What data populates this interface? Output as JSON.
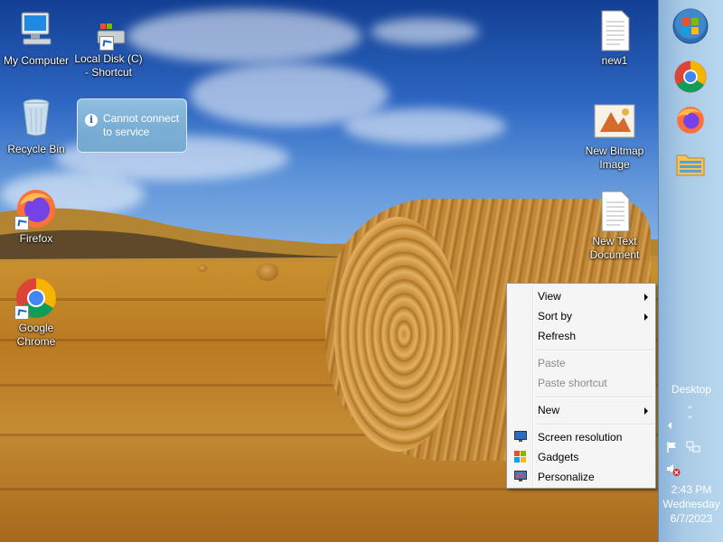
{
  "desktop": {
    "icons": [
      {
        "label": "My Computer",
        "icon": "computer-icon"
      },
      {
        "label": "Local Disk (C) - Shortcut",
        "icon": "drive-icon"
      },
      {
        "label": "Recycle Bin",
        "icon": "recycle-bin-icon"
      },
      {
        "label": "Firefox",
        "icon": "firefox-icon"
      },
      {
        "label": "Google Chrome",
        "icon": "chrome-icon"
      },
      {
        "label": "new1",
        "icon": "text-file-icon"
      },
      {
        "label": "New Bitmap Image",
        "icon": "bitmap-icon"
      },
      {
        "label": "New Text Document",
        "icon": "text-file-icon"
      }
    ]
  },
  "notification": {
    "text": "Cannot connect to service",
    "icon": "info-icon"
  },
  "context_menu": {
    "items": [
      {
        "label": "View",
        "has_submenu": true
      },
      {
        "label": "Sort by",
        "has_submenu": true
      },
      {
        "label": "Refresh"
      },
      {
        "label": "Paste",
        "disabled": true
      },
      {
        "label": "Paste shortcut",
        "disabled": true
      },
      {
        "label": "New",
        "has_submenu": true
      },
      {
        "label": "Screen resolution",
        "icon": "display-icon"
      },
      {
        "label": "Gadgets",
        "icon": "gadgets-icon"
      },
      {
        "label": "Personalize",
        "icon": "personalize-icon"
      }
    ]
  },
  "taskbar": {
    "buttons": [
      "start-orb-icon",
      "chrome-icon",
      "firefox-icon",
      "explorer-icon"
    ],
    "desktop_label": "Desktop",
    "clock": {
      "time": "2:43 PM",
      "day": "Wednesday",
      "date": "6/7/2023"
    }
  },
  "colors": {
    "taskbar": "#a9cbe6",
    "menu_bg": "#f5f5f5",
    "sky_top": "#123f93"
  }
}
